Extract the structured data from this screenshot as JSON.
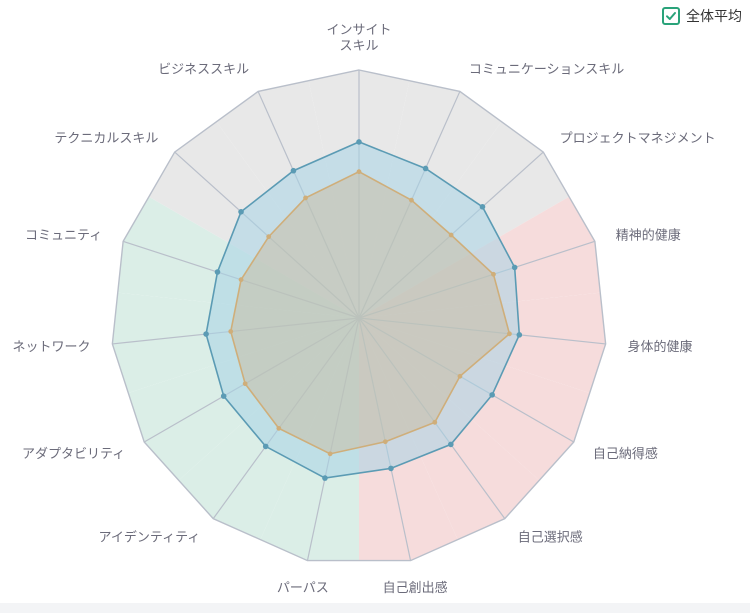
{
  "legend": {
    "label": "全体平均",
    "checked": true,
    "check_color": "#2aa37a"
  },
  "chart_data": {
    "type": "radar",
    "axes": [
      "インサイト\nスキル",
      "コミュニケーションスキル",
      "プロジェクトマネジメント",
      "精神的健康",
      "身体的健康",
      "自己納得感",
      "自己選択感",
      "自己創出感",
      "パーパス",
      "アイデンティティ",
      "アダプタビリティ",
      "ネットワーク",
      "コミュニティ",
      "テクニカルスキル",
      "ビジネススキル"
    ],
    "range": [
      0,
      100
    ],
    "grid": true,
    "sectors": [
      {
        "axes": [
          0,
          1,
          2
        ],
        "color": "#e8e8e8"
      },
      {
        "axes": [
          3,
          4,
          5,
          6,
          7
        ],
        "color": "#f6dcdc"
      },
      {
        "axes": [
          8,
          9,
          10,
          11,
          12
        ],
        "color": "#dbeee7"
      },
      {
        "axes": [
          13,
          14
        ],
        "color": "#e8e8e8"
      }
    ],
    "series": [
      {
        "name": "全体平均",
        "values": [
          71,
          66,
          67,
          66,
          65,
          62,
          63,
          62,
          66,
          64,
          63,
          62,
          60,
          64,
          65
        ],
        "line_color": "#5b9bb4",
        "fill_color": "#a8d4e6",
        "fill_opacity": 0.55
      },
      {
        "values": [
          59,
          52,
          50,
          57,
          61,
          47,
          52,
          51,
          56,
          55,
          53,
          52,
          50,
          49,
          53
        ],
        "line_color": "#cfae7a",
        "fill_color": "#c9b79a",
        "fill_opacity": 0.45
      }
    ]
  }
}
